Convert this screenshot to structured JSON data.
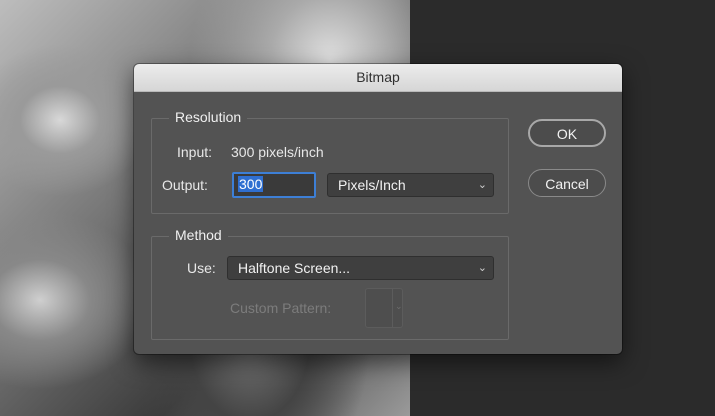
{
  "dialog": {
    "title": "Bitmap",
    "resolution": {
      "group_title": "Resolution",
      "input_label": "Input:",
      "input_value": "300 pixels/inch",
      "output_label": "Output:",
      "output_value": "300",
      "output_unit": "Pixels/Inch"
    },
    "method": {
      "group_title": "Method",
      "use_label": "Use:",
      "use_value": "Halftone Screen...",
      "custom_pattern_label": "Custom Pattern:"
    },
    "buttons": {
      "ok": "OK",
      "cancel": "Cancel"
    }
  },
  "colors": {
    "dialog_bg": "#535353",
    "titlebar_bg": "#dcdcdc",
    "focus_ring": "#3d7fd6"
  }
}
